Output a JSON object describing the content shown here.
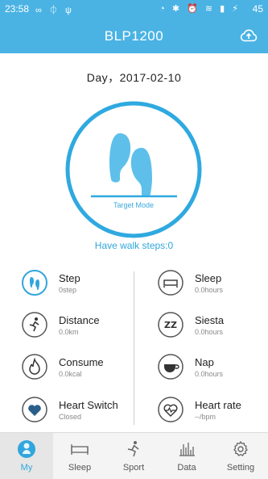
{
  "status_bar": {
    "time": "23:58",
    "left_icons": "∞ ⏀ ψ",
    "right_icons": "◔ ✱ ⏰ ≋ ▮ ⚡",
    "battery": "45"
  },
  "header": {
    "title": "BLP1200",
    "upload_icon": "cloud-upload-icon"
  },
  "date_label": "Day，2017-02-10",
  "ring": {
    "mode_label": "Target Mode",
    "icon": "footsteps-icon"
  },
  "walk_steps": "Have walk steps:0",
  "metrics": [
    {
      "name": "Step",
      "value": "0step",
      "icon": "footsteps-icon"
    },
    {
      "name": "Sleep",
      "value": "0.0hours",
      "icon": "bed-icon"
    },
    {
      "name": "Distance",
      "value": "0.0km",
      "icon": "runner-icon"
    },
    {
      "name": "Siesta",
      "value": "0.0hours",
      "icon": "zz-icon"
    },
    {
      "name": "Consume",
      "value": "0.0kcal",
      "icon": "flame-icon"
    },
    {
      "name": "Nap",
      "value": "0.0hours",
      "icon": "cup-icon"
    },
    {
      "name": "Heart Switch",
      "value": "Closed",
      "icon": "heart-icon"
    },
    {
      "name": "Heart rate",
      "value": "--/bpm",
      "icon": "heart-pulse-icon"
    }
  ],
  "tabs": [
    {
      "label": "My",
      "icon": "person-icon",
      "active": true
    },
    {
      "label": "Sleep",
      "icon": "bed-icon"
    },
    {
      "label": "Sport",
      "icon": "runner-icon"
    },
    {
      "label": "Data",
      "icon": "bar-chart-icon"
    },
    {
      "label": "Setting",
      "icon": "gear-icon"
    }
  ],
  "colors": {
    "primary": "#4ab3e4",
    "accent": "#31a6dd",
    "muted": "#888888"
  }
}
